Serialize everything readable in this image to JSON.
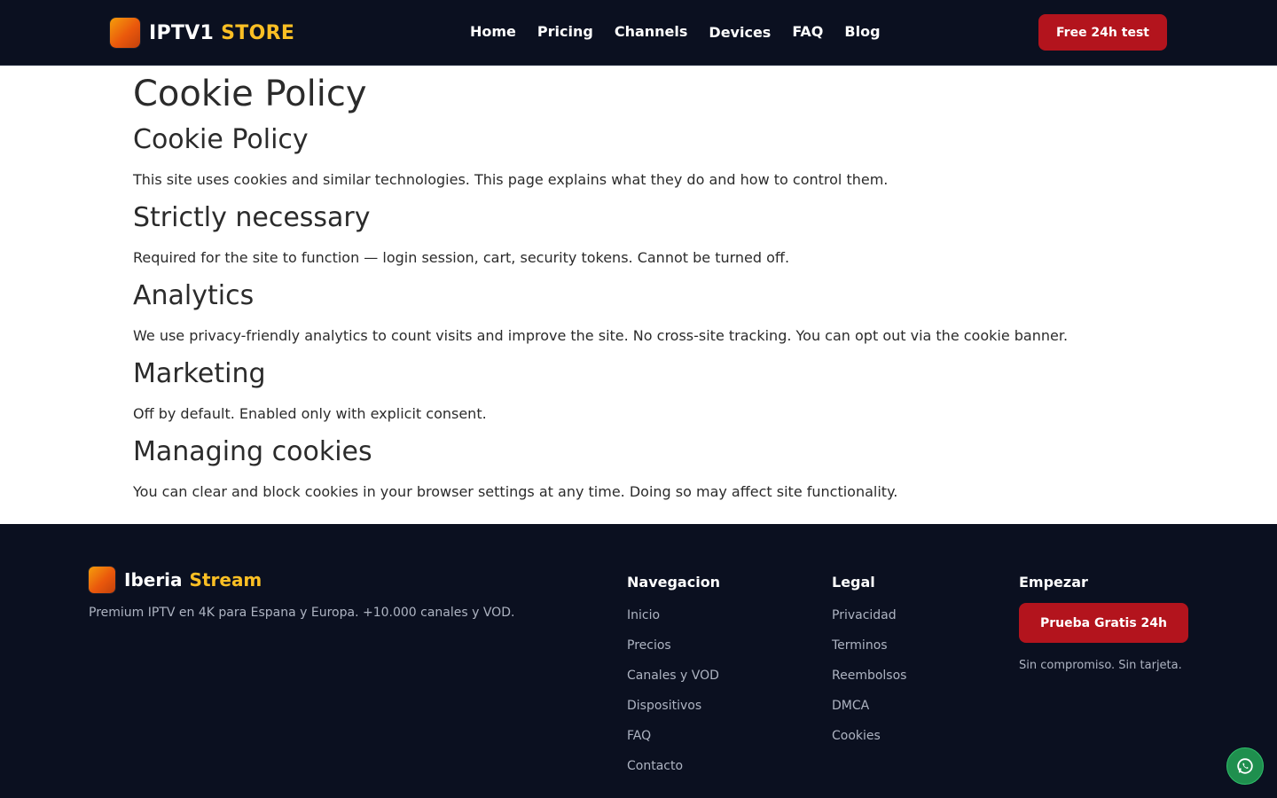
{
  "header": {
    "brand_primary": "IPTV1",
    "brand_secondary": "STORE",
    "nav": [
      "Home",
      "Pricing",
      "Channels",
      "Devices",
      "FAQ",
      "Blog"
    ],
    "cta": "Free 24h test"
  },
  "content": {
    "title": "Cookie Policy",
    "sections": [
      {
        "heading": "Cookie Policy",
        "text": "This site uses cookies and similar technologies. This page explains what they do and how to control them."
      },
      {
        "heading": "Strictly necessary",
        "text": "Required for the site to function — login session, cart, security tokens. Cannot be turned off."
      },
      {
        "heading": "Analytics",
        "text": "We use privacy-friendly analytics to count visits and improve the site. No cross-site tracking. You can opt out via the cookie banner."
      },
      {
        "heading": "Marketing",
        "text": "Off by default. Enabled only with explicit consent."
      },
      {
        "heading": "Managing cookies",
        "text": "You can clear and block cookies in your browser settings at any time. Doing so may affect site functionality."
      }
    ]
  },
  "footer": {
    "brand_primary": "Iberia",
    "brand_secondary": "Stream",
    "description": "Premium IPTV en 4K para Espana y Europa. +10.000 canales y VOD.",
    "nav_title": "Navegacion",
    "nav_links": [
      "Inicio",
      "Precios",
      "Canales y VOD",
      "Dispositivos",
      "FAQ",
      "Contacto"
    ],
    "legal_title": "Legal",
    "legal_links": [
      "Privacidad",
      "Terminos",
      "Reembolsos",
      "DMCA",
      "Cookies"
    ],
    "start_title": "Empezar",
    "start_cta": "Prueba Gratis 24h",
    "start_note": "Sin compromiso. Sin tarjeta."
  },
  "colors": {
    "dark_bg": "#0b1020",
    "accent_red": "#b3141d",
    "accent_yellow": "#fbbf24",
    "whatsapp_green": "#1f8f4e"
  },
  "icons": {
    "brand_logo": "gradient-square-logo",
    "floating_button": "whatsapp-icon"
  }
}
